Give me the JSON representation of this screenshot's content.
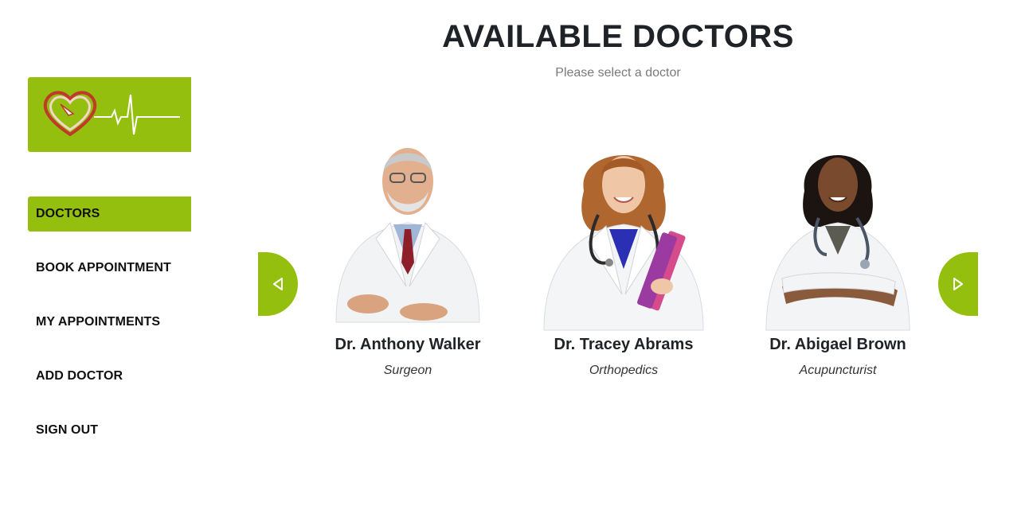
{
  "header": {
    "title": "AVAILABLE DOCTORS",
    "subtitle": "Please select a doctor"
  },
  "brand": {
    "accent_color": "#95bf0f",
    "logo_icon": "heart-pulse-logo"
  },
  "sidebar": {
    "items": [
      {
        "label": "DOCTORS",
        "active": true
      },
      {
        "label": "BOOK APPOINTMENT",
        "active": false
      },
      {
        "label": "MY APPOINTMENTS",
        "active": false
      },
      {
        "label": "ADD DOCTOR",
        "active": false
      },
      {
        "label": "SIGN OUT",
        "active": false
      }
    ]
  },
  "carousel": {
    "prev_icon": "triangle-left-icon",
    "next_icon": "triangle-right-icon",
    "doctors": [
      {
        "name": "Dr. Anthony Walker",
        "specialty": "Surgeon"
      },
      {
        "name": "Dr. Tracey Abrams",
        "specialty": "Orthopedics"
      },
      {
        "name": "Dr. Abigael Brown",
        "specialty": "Acupuncturist"
      }
    ]
  }
}
